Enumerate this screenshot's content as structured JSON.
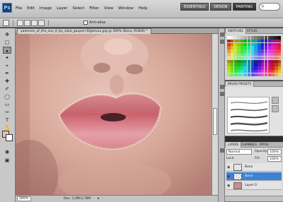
{
  "app": {
    "logo": "Ps"
  },
  "menu": [
    "File",
    "Edit",
    "Image",
    "Layer",
    "Select",
    "Filter",
    "View",
    "Window",
    "Help"
  ],
  "workspaces": [
    "ESSENTIALS",
    "DESIGN",
    "PAINTING"
  ],
  "workspace_active": "PAINTING",
  "options": {
    "anti_alias_label": "Anti-alias"
  },
  "document": {
    "tab_title": "yadenise_of_the_sun_it_by_sipla_gauperr.0/jplevuu.jpg @ 300% (Boca, RGB/8) *",
    "zoom": "300%",
    "doc_size": "Doc: 1,9M/3,78M"
  },
  "panels": {
    "swatches_tabs": [
      "SWATCHES",
      "STYLES"
    ],
    "brush_tab": "BRUSH PRESETS",
    "layers_tabs": [
      "LAYERS",
      "CHANNELS",
      "PATHS"
    ]
  },
  "layers": {
    "blend_mode": "Normal",
    "opacity_label": "Opacity:",
    "opacity": "100%",
    "lock_label": "Lock:",
    "fill_label": "Fill:",
    "fill": "100%",
    "items": [
      {
        "name": "Boca"
      },
      {
        "name": "Boca"
      },
      {
        "name": "Layer 0"
      }
    ]
  },
  "colors": {
    "foreground": "#e8c0ae",
    "background": "#ffffff",
    "selection": "#3d82d6"
  }
}
